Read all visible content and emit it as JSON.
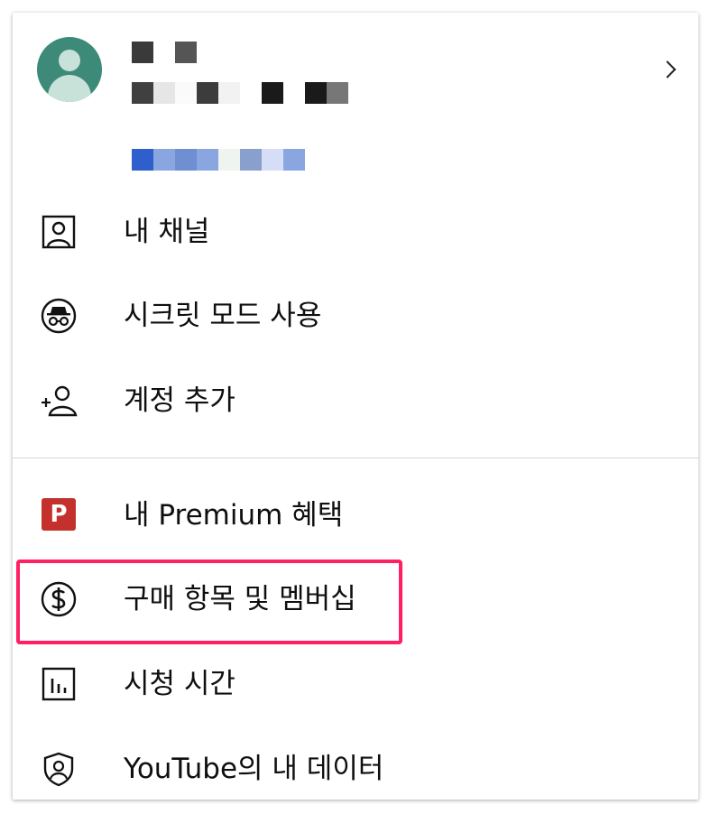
{
  "colors": {
    "accent_highlight": "#ff1f63",
    "premium_red": "#c4302b",
    "avatar_bg": "#3d8a78"
  },
  "account": {
    "manage_chevron": "›"
  },
  "menu_primary": [
    {
      "label": "내 채널",
      "icon": "person-box-icon"
    },
    {
      "label": "시크릿 모드 사용",
      "icon": "incognito-icon"
    },
    {
      "label": "계정 추가",
      "icon": "add-person-icon"
    }
  ],
  "menu_secondary": [
    {
      "label": "내 Premium 혜택",
      "icon": "premium-icon",
      "badge": "P"
    },
    {
      "label": "구매 항목 및 멤버십",
      "icon": "dollar-icon",
      "highlighted": true
    },
    {
      "label": "시청 시간",
      "icon": "bar-chart-icon"
    },
    {
      "label": "YouTube의 내 데이터",
      "icon": "shield-person-icon"
    }
  ]
}
